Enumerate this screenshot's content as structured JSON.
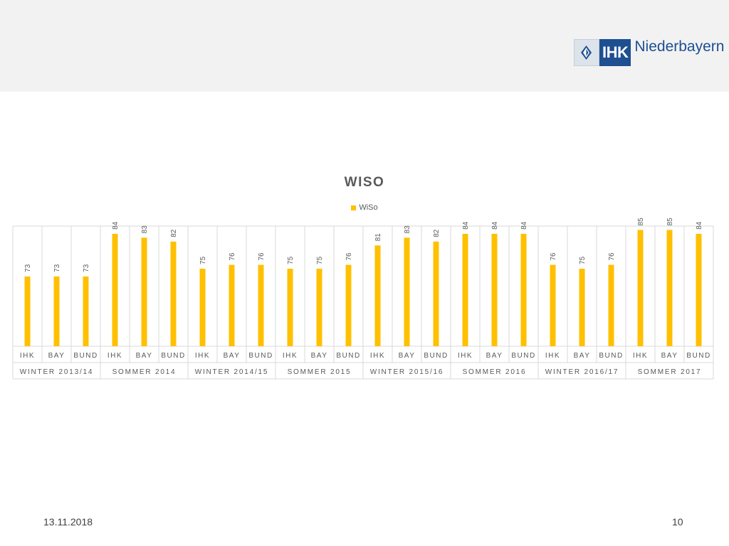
{
  "header": {
    "logo_text": "IHK",
    "logo_name": "Niederbayern"
  },
  "footer": {
    "date": "13.11.2018",
    "page": "10"
  },
  "colors": {
    "bar": "#ffc000",
    "grid": "#d9d9d9",
    "text": "#595959"
  },
  "chart_data": {
    "type": "bar",
    "title": "WISO",
    "legend": "top",
    "series": [
      {
        "name": "WiSo",
        "values": [
          73,
          73,
          73,
          84,
          83,
          82,
          75,
          76,
          76,
          75,
          75,
          76,
          81,
          83,
          82,
          84,
          84,
          84,
          76,
          75,
          76,
          85,
          85,
          84
        ]
      }
    ],
    "categories": [
      "IHK",
      "BAY",
      "BUND",
      "IHK",
      "BAY",
      "BUND",
      "IHK",
      "BAY",
      "BUND",
      "IHK",
      "BAY",
      "BUND",
      "IHK",
      "BAY",
      "BUND",
      "IHK",
      "BAY",
      "BUND",
      "IHK",
      "BAY",
      "BUND",
      "IHK",
      "BAY",
      "BUND"
    ],
    "groups": [
      "WINTER 2013/14",
      "SOMMER 2014",
      "WINTER 2014/15",
      "SOMMER 2015",
      "WINTER 2015/16",
      "SOMMER 2016",
      "WINTER 2016/17",
      "SOMMER 2017"
    ],
    "ylim": [
      55,
      86
    ],
    "grid": true,
    "data_labels": true
  }
}
